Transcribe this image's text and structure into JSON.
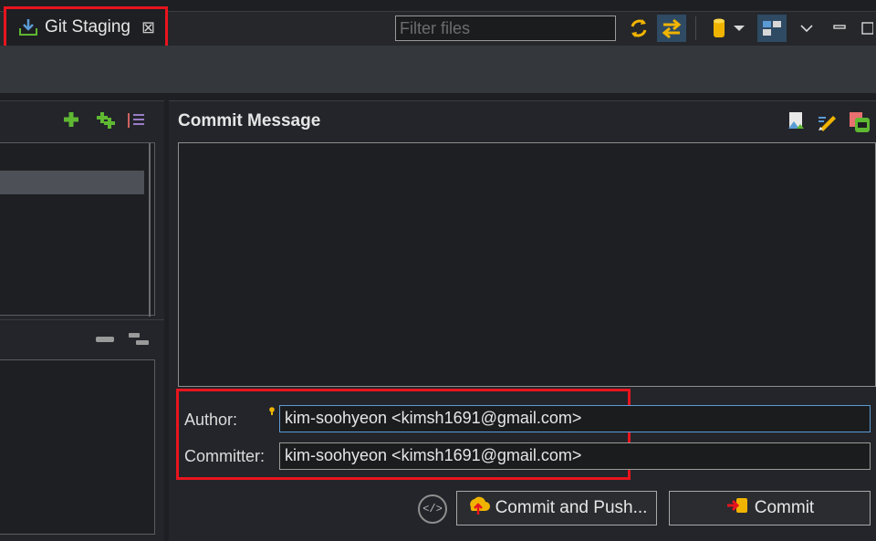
{
  "tab": {
    "label": "Git Staging",
    "close_glyph": "⊠"
  },
  "filter": {
    "placeholder": "Filter files",
    "value": ""
  },
  "toolbar": {
    "icons": [
      "refresh-icon",
      "compare-icon",
      "repository-icon",
      "dropdown-icon",
      "layout-icon",
      "view-menu-icon",
      "minimize-icon",
      "maximize-icon"
    ]
  },
  "unstaged": {
    "header_icons": [
      "add-icon",
      "add-all-icon",
      "sort-icon"
    ]
  },
  "staged": {
    "header_icons": [
      "collapse-icon",
      "tree-icon"
    ]
  },
  "commit": {
    "title": "Commit Message",
    "message": "",
    "author_label": "Author:",
    "author_value": "kim-soohyeon <kimsh1691@gmail.com>",
    "committer_label": "Committer:",
    "committer_value": "kim-soohyeon <kimsh1691@gmail.com>",
    "commit_push_label": "Commit and Push...",
    "commit_label": "Commit",
    "circle_glyph": "</>"
  },
  "colors": {
    "highlight": "#e8141e",
    "background": "#1e1f22",
    "panel": "#23252a",
    "band": "#34373c",
    "accent_blue": "#5b9bd5",
    "icon_yellow": "#f0b400",
    "icon_green": "#5fb832"
  }
}
